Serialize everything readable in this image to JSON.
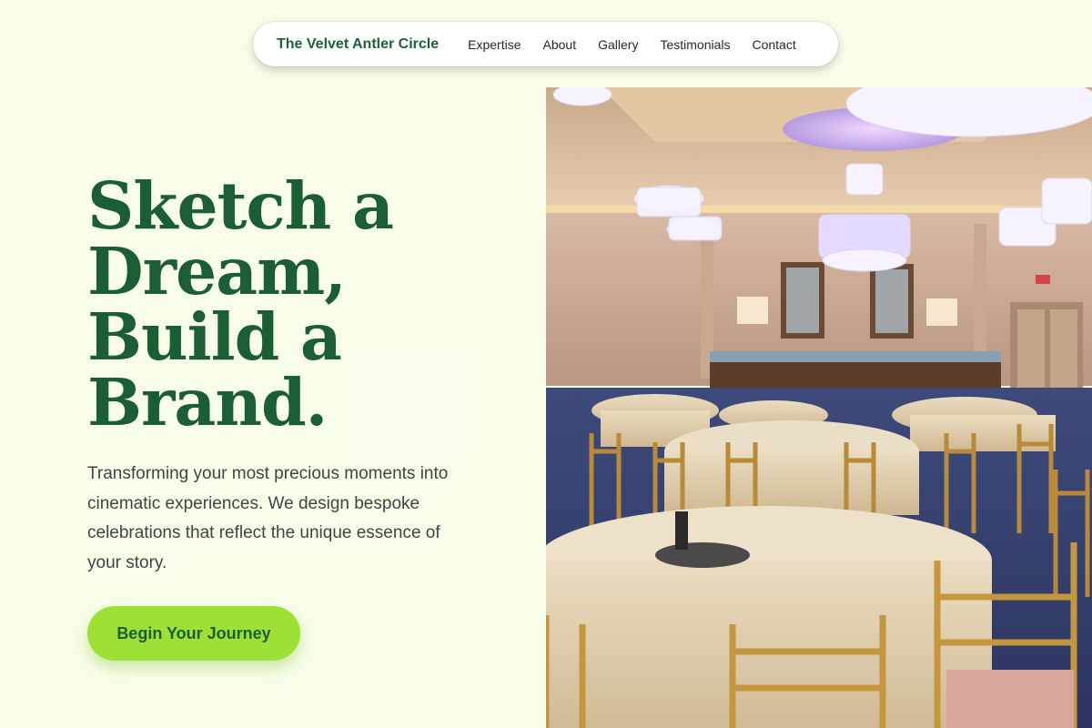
{
  "nav": {
    "brand": "The Velvet Antler Circle",
    "links": [
      "Expertise",
      "About",
      "Gallery",
      "Testimonials",
      "Contact"
    ]
  },
  "hero": {
    "headline_lines": [
      "Sketch a",
      "Dream,",
      "Build a",
      "Brand."
    ],
    "subtext": "Transforming your most precious moments into cinematic experiences. We design bespoke celebrations that reflect the unique essence of your story.",
    "cta_label": "Begin Your Journey"
  },
  "image": {
    "subject": "ballroom-with-chandeliers-and-round-tables"
  },
  "colors": {
    "background": "#f7fde6",
    "brand_green": "#1b6238",
    "headline_green": "#1b5e36",
    "cta_bg": "#9ee136",
    "body_text": "#3a4745"
  }
}
